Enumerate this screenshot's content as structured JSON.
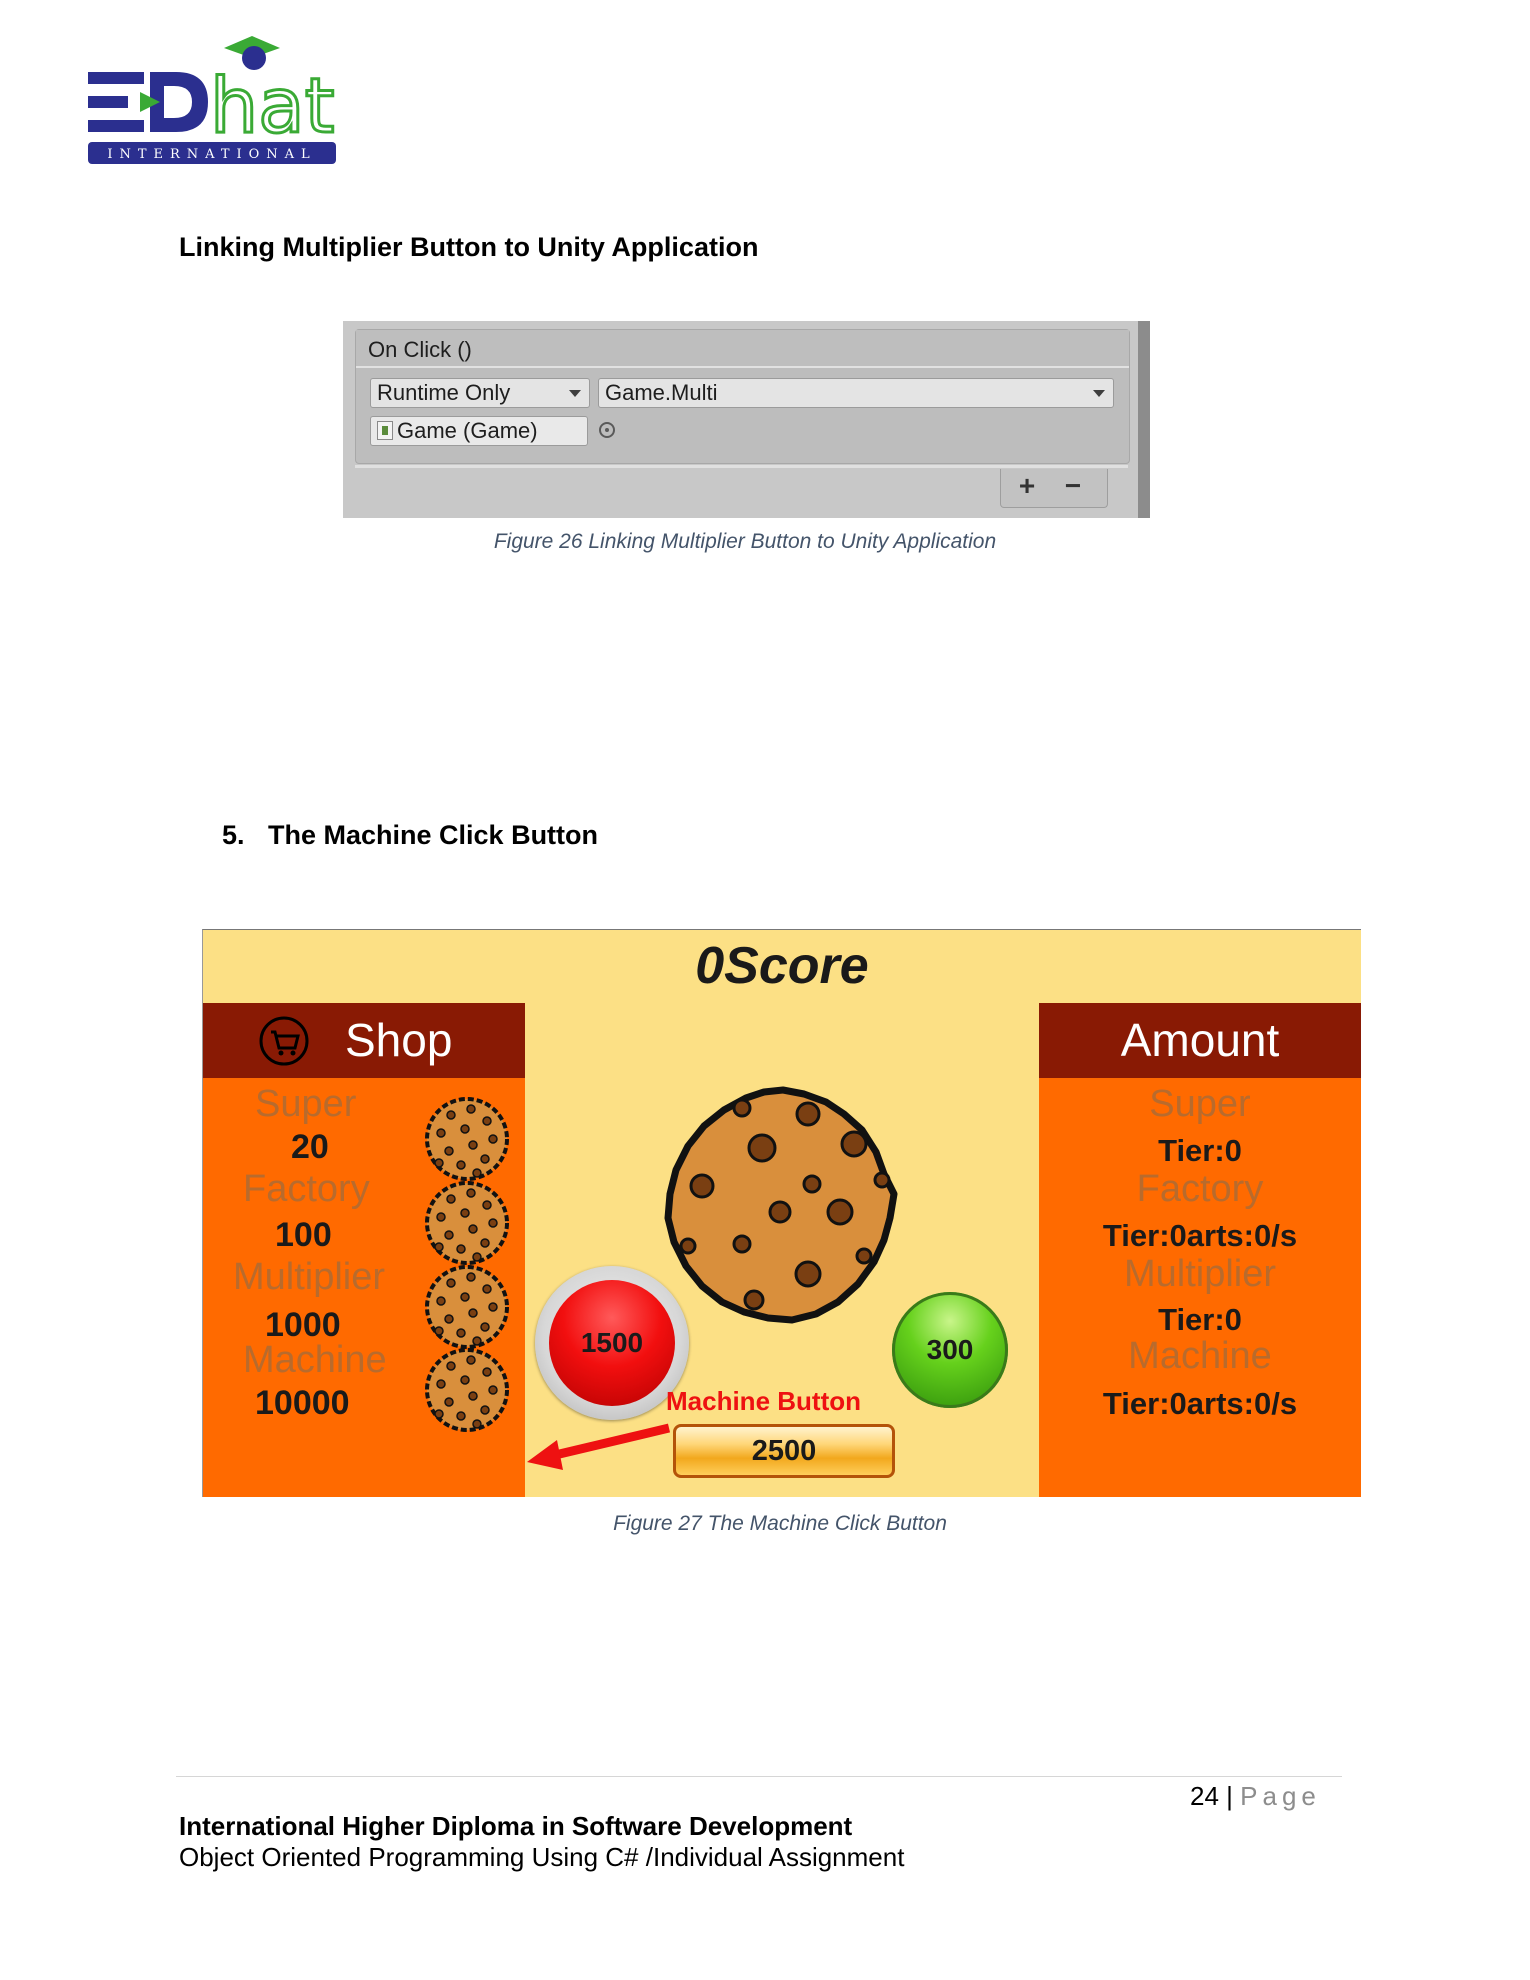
{
  "logo": {
    "wordmark": "hat",
    "tagline": "INTERNATIONAL"
  },
  "section_heading": "Linking Multiplier Button to Unity Application",
  "figure26": {
    "event_title": "On Click ()",
    "runtime_dropdown": "Runtime Only",
    "method_dropdown": "Game.Multi",
    "object_field": "Game (Game)",
    "plus_label": "+",
    "minus_label": "−",
    "caption": "Figure 26 Linking Multiplier Button to Unity Application"
  },
  "numbered_heading": {
    "number": "5.",
    "text": "The Machine Click Button"
  },
  "figure27": {
    "score": "0Score",
    "shop": {
      "title": "Shop",
      "items": [
        {
          "name": "Super",
          "price": "20"
        },
        {
          "name": "Factory",
          "price": "100"
        },
        {
          "name": "Multiplier",
          "price": "1000"
        },
        {
          "name": "Machine",
          "price": "10000"
        }
      ]
    },
    "amount": {
      "title": "Amount",
      "items": [
        {
          "name": "Super",
          "value": "Tier:0"
        },
        {
          "name": "Factory",
          "value": "Tier:0arts:0/s"
        },
        {
          "name": "Multiplier",
          "value": "Tier:0"
        },
        {
          "name": "Machine",
          "value": "Tier:0arts:0/s"
        }
      ]
    },
    "red_button": "1500",
    "green_button": "300",
    "machine_label": "Machine Button",
    "machine_button": "2500",
    "colors": {
      "background": "#fce085",
      "panel": "#ff6a00",
      "panel_header": "#891a04",
      "annotation": "#ee1111"
    },
    "caption": "Figure 27 The Machine Click Button"
  },
  "footer": {
    "page_number": "24",
    "separator": "|",
    "page_word": "Page",
    "title": "International Higher Diploma in Software Development",
    "subtitle": "Object Oriented Programming Using C# /Individual Assignment"
  }
}
